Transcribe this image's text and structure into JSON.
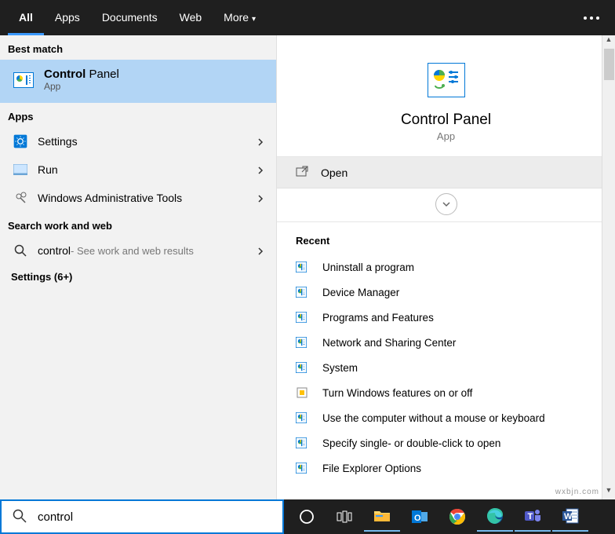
{
  "tabs": {
    "all": "All",
    "apps": "Apps",
    "documents": "Documents",
    "web": "Web",
    "more": "More"
  },
  "section": {
    "best": "Best match",
    "apps": "Apps",
    "searchWeb": "Search work and web"
  },
  "best": {
    "titleBold": "Control",
    "titleLight": " Panel",
    "sub": "App"
  },
  "appsList": {
    "0": {
      "label": "Settings"
    },
    "1": {
      "label": "Run"
    },
    "2": {
      "label": "Windows Administrative Tools"
    }
  },
  "web": {
    "query": "control",
    "suffix": " - See work and web results"
  },
  "settingsMore": "Settings (6+)",
  "preview": {
    "title": "Control Panel",
    "sub": "App",
    "open": "Open",
    "recentHeader": "Recent"
  },
  "recent": {
    "0": "Uninstall a program",
    "1": "Device Manager",
    "2": "Programs and Features",
    "3": "Network and Sharing Center",
    "4": "System",
    "5": "Turn Windows features on or off",
    "6": "Use the computer without a mouse or keyboard",
    "7": "Specify single- or double-click to open",
    "8": "File Explorer Options"
  },
  "search": {
    "value": "control"
  },
  "watermark": "wxbjn.com"
}
